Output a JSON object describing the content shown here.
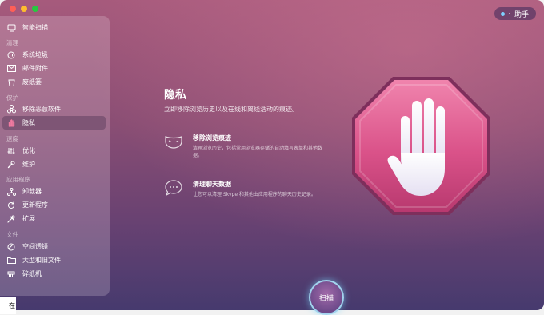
{
  "assistant": {
    "label": "助手"
  },
  "sidebar": {
    "top_item": {
      "label": "智能扫描",
      "icon": "monitor-icon"
    },
    "sections": [
      {
        "title": "清理",
        "items": [
          {
            "label": "系统垃圾",
            "icon": "trash-circle-icon"
          },
          {
            "label": "邮件附件",
            "icon": "envelope-icon"
          },
          {
            "label": "废纸篓",
            "icon": "bin-icon"
          }
        ]
      },
      {
        "title": "保护",
        "items": [
          {
            "label": "移除恶意软件",
            "icon": "biohazard-icon"
          },
          {
            "label": "隐私",
            "icon": "hand-icon"
          }
        ]
      },
      {
        "title": "速度",
        "items": [
          {
            "label": "优化",
            "icon": "sliders-icon"
          },
          {
            "label": "维护",
            "icon": "wrench-icon"
          }
        ]
      },
      {
        "title": "应用程序",
        "items": [
          {
            "label": "卸载器",
            "icon": "uninstaller-icon"
          },
          {
            "label": "更新程序",
            "icon": "update-icon"
          },
          {
            "label": "扩展",
            "icon": "extension-icon"
          }
        ]
      },
      {
        "title": "文件",
        "items": [
          {
            "label": "空间透镜",
            "icon": "lens-icon"
          },
          {
            "label": "大型和旧文件",
            "icon": "folder-icon"
          },
          {
            "label": "碎纸机",
            "icon": "shredder-icon"
          }
        ]
      }
    ]
  },
  "main": {
    "title": "隐私",
    "subtitle": "立即移除浏览历史以及在线和离线活动的痕迹。",
    "features": [
      {
        "title": "移除浏览痕迹",
        "desc": "清理浏览历史，包括常用浏览器存储的自动填写表单和其他数据。",
        "icon": "mask-icon"
      },
      {
        "title": "清理聊天数据",
        "desc": "让您可以清理 Skype 和其他由应用程序的聊天历史记录。",
        "icon": "chat-bubble-icon"
      }
    ],
    "hero_icon": "stop-hand-icon"
  },
  "scan_button": {
    "label": "扫描"
  },
  "edge_text": "在"
}
